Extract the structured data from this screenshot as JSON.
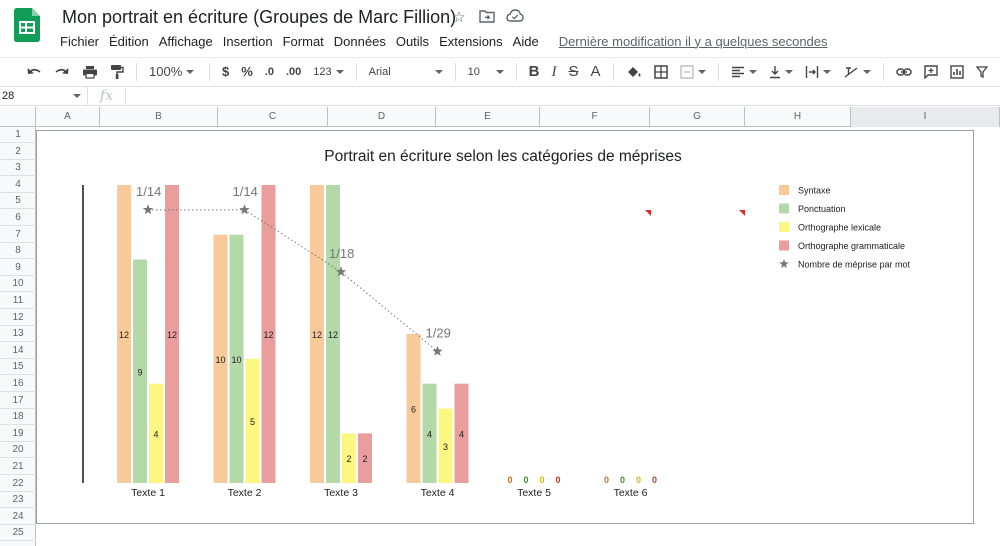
{
  "app": {
    "doc_title": "Mon portrait en écriture (Groupes de Marc Fillion)",
    "menu": [
      "Fichier",
      "Édition",
      "Affichage",
      "Insertion",
      "Format",
      "Données",
      "Outils",
      "Extensions",
      "Aide"
    ],
    "last_edit": "Dernière modification il y a quelques secondes",
    "brand_color": "#0f9d58"
  },
  "toolbar": {
    "zoom": "100%",
    "currency": "$",
    "percent": "%",
    "decrease_decimals": ".0",
    "increase_decimals": ".00",
    "more_formats": "123",
    "font": "Arial",
    "font_size": "10",
    "bold": "B",
    "italic": "I",
    "strikethrough": "S",
    "text_color": "A"
  },
  "formula_bar": {
    "name_box": "28",
    "fx_label": "fx"
  },
  "sheet": {
    "columns": [
      "A",
      "B",
      "C",
      "D",
      "E",
      "F",
      "G",
      "H",
      "I"
    ],
    "rows": [
      "1",
      "2",
      "3",
      "4",
      "5",
      "6",
      "7",
      "8",
      "9",
      "10",
      "11",
      "12",
      "13",
      "14",
      "15",
      "16",
      "17",
      "18",
      "19",
      "20",
      "21",
      "22",
      "23",
      "24",
      "25"
    ]
  },
  "chart_data": {
    "type": "bar",
    "title": "Portrait en écriture selon les catégories de méprises",
    "categories": [
      "Texte 1",
      "Texte 2",
      "Texte 3",
      "Texte 4",
      "Texte 5",
      "Texte 6"
    ],
    "series": [
      {
        "name": "Syntaxe",
        "color": "#f8c999",
        "values": [
          12,
          10,
          12,
          6,
          0,
          0
        ]
      },
      {
        "name": "Ponctuation",
        "color": "#b3d9a8",
        "values": [
          9,
          10,
          12,
          4,
          0,
          0
        ]
      },
      {
        "name": "Orthographe lexicale",
        "color": "#fbf780",
        "values": [
          4,
          5,
          2,
          3,
          0,
          0
        ]
      },
      {
        "name": "Orthographe grammaticale",
        "color": "#e99d9d",
        "values": [
          12,
          12,
          2,
          4,
          0,
          0
        ]
      }
    ],
    "line_series": {
      "name": "Nombre de méprise par mot",
      "marker": "star",
      "style": "dotted",
      "color": "#777777",
      "points": [
        {
          "category": "Texte 1",
          "label": "1/14",
          "level": 11
        },
        {
          "category": "Texte 2",
          "label": "1/14",
          "level": 11
        },
        {
          "category": "Texte 3",
          "label": "1/18",
          "level": 8.5
        },
        {
          "category": "Texte 4",
          "label": "1/29",
          "level": 5.3
        }
      ]
    },
    "ylim": [
      0,
      12
    ],
    "legend_position": "right",
    "gridlines": false
  }
}
